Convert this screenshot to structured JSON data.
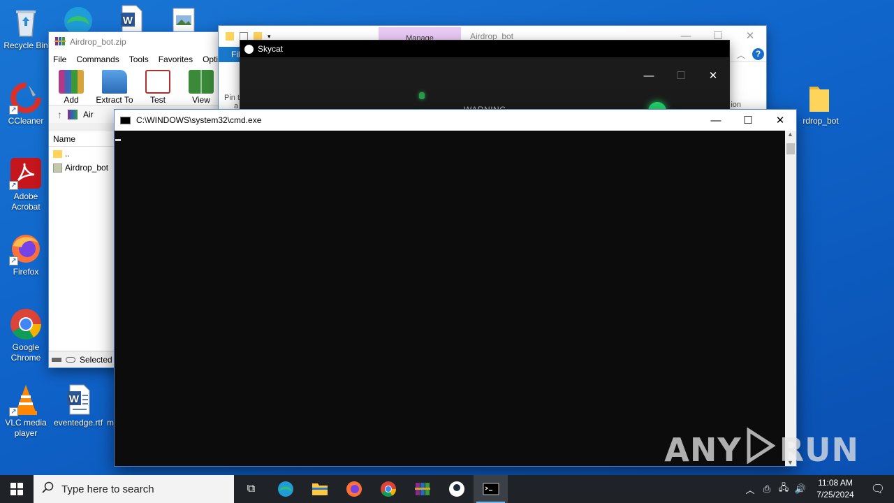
{
  "desktop": {
    "icons": [
      {
        "label": "Recycle Bin"
      },
      {
        "label": "CCleaner"
      },
      {
        "label": "Adobe Acrobat"
      },
      {
        "label": "Firefox"
      },
      {
        "label": "Google Chrome"
      },
      {
        "label": "VLC media player"
      },
      {
        "label": "eventedge.rtf"
      },
      {
        "label": "m"
      },
      {
        "label": "rdrop_bot"
      }
    ]
  },
  "winrar": {
    "title": "Airdrop_bot.zip",
    "menu": [
      "File",
      "Commands",
      "Tools",
      "Favorites",
      "Optio"
    ],
    "tools": [
      "Add",
      "Extract To",
      "Test",
      "View"
    ],
    "address": "Air",
    "column_name": "Name",
    "rows": [
      "..",
      "Airdrop_bot"
    ],
    "status": "Selected"
  },
  "explorer": {
    "manage_label": "Manage",
    "title": "Airdrop_bot",
    "file_tab": "Fil",
    "partial_left": "Pin t",
    "partial_left2": "a",
    "partial_right": "ion"
  },
  "skycat": {
    "title": "Skycat",
    "warning": "WARNING"
  },
  "cmd": {
    "title": "C:\\WINDOWS\\system32\\cmd.exe"
  },
  "taskbar": {
    "search_placeholder": "Type here to search",
    "time": "11:08 AM",
    "date": "7/25/2024"
  },
  "watermark": {
    "left": "ANY",
    "right": "RUN"
  },
  "colors": {
    "desktop_blue": "#0f63c9",
    "taskbar": "#1f2327",
    "manage_tab": "#e9c9f5",
    "file_tab": "#1979ca"
  }
}
